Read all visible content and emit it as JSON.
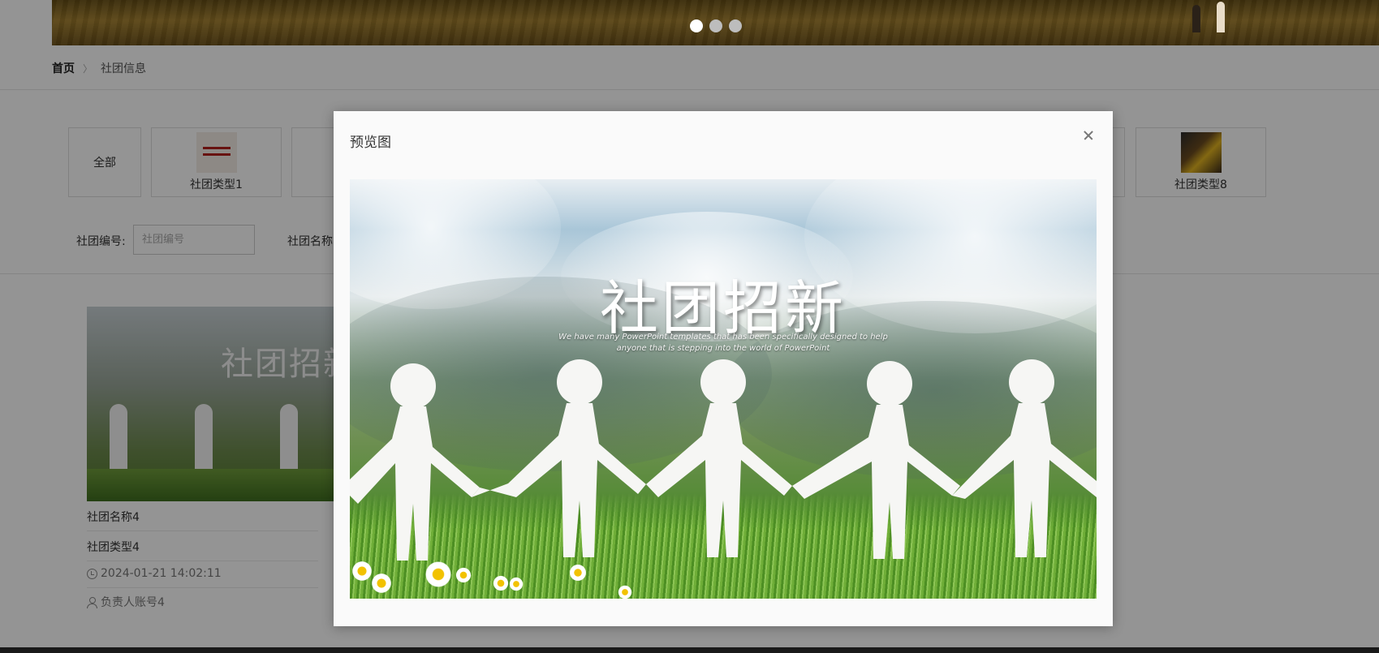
{
  "banner": {
    "slides": 3,
    "active_slide": 1
  },
  "breadcrumb": {
    "home": "首页",
    "separator": "〉",
    "current": "社团信息"
  },
  "categories": {
    "all": "全部",
    "type1": "社团类型1",
    "type8": "社团类型8"
  },
  "filters": {
    "code_label": "社团编号:",
    "code_placeholder": "社团编号",
    "name_label": "社团名称"
  },
  "card": {
    "image_title": "社团招新",
    "name": "社团名称4",
    "type": "社团类型4",
    "time": "2024-01-21 14:02:11",
    "owner": "负责人账号4"
  },
  "modal": {
    "title": "预览图",
    "image": {
      "headline": "社团招新",
      "subline_1": "We have many PowerPoint templates that has been specifically designed to help",
      "subline_2": "anyone that is stepping into the world of PowerPoint"
    }
  },
  "colors": {
    "overlay": "#000000",
    "modal_bg": "#fafafa",
    "accent_grass": "#4e8a2e"
  }
}
